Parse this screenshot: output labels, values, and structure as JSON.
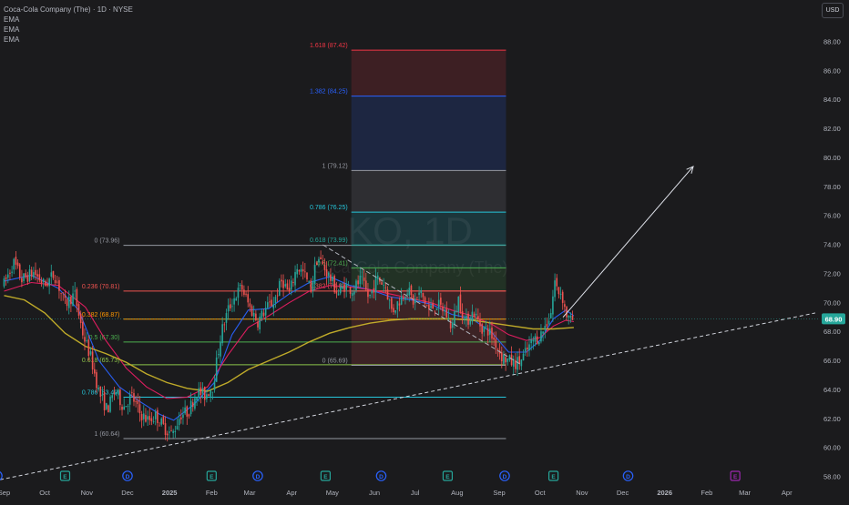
{
  "header": {
    "title": "Coca-Cola Company (The) · 1D · NYSE",
    "indicators": [
      "EMA",
      "EMA",
      "EMA"
    ],
    "currency": "USD"
  },
  "watermark": {
    "ticker": "KO, 1D",
    "name": "Coca-Cola Company (The)"
  },
  "colors": {
    "background": "#1b1b1d",
    "up_candle": "#26a69a",
    "down_candle": "#ef5350",
    "ema_fast": "#2962ff",
    "ema_mid": "#e91e63",
    "ema_slow": "#c8b22a",
    "price_badge": "#26a69a"
  },
  "chart_data": {
    "type": "candlestick",
    "ylim": [
      57.5,
      89.5
    ],
    "y_ticks": [
      "58.00",
      "60.00",
      "62.00",
      "64.00",
      "66.00",
      "68.00",
      "70.00",
      "72.00",
      "74.00",
      "76.00",
      "78.00",
      "80.00",
      "82.00",
      "84.00",
      "86.00",
      "88.00"
    ],
    "x_ticks": [
      {
        "label": "Sep",
        "t": 0
      },
      {
        "label": "Oct",
        "t": 30
      },
      {
        "label": "Nov",
        "t": 61
      },
      {
        "label": "Dec",
        "t": 91
      },
      {
        "label": "2025",
        "t": 122
      },
      {
        "label": "Feb",
        "t": 153
      },
      {
        "label": "Mar",
        "t": 181
      },
      {
        "label": "Apr",
        "t": 212
      },
      {
        "label": "May",
        "t": 242
      },
      {
        "label": "Jun",
        "t": 273
      },
      {
        "label": "Jul",
        "t": 303
      },
      {
        "label": "Aug",
        "t": 334
      },
      {
        "label": "Sep",
        "t": 365
      },
      {
        "label": "Oct",
        "t": 395
      },
      {
        "label": "Nov",
        "t": 426
      },
      {
        "label": "Dec",
        "t": 456
      },
      {
        "label": "2026",
        "t": 487
      },
      {
        "label": "Feb",
        "t": 518
      },
      {
        "label": "Mar",
        "t": 546
      },
      {
        "label": "Apr",
        "t": 577
      }
    ],
    "x_range_days": [
      -3,
      598
    ],
    "current_price": "68.90",
    "price_path": [
      [
        0,
        71.3
      ],
      [
        7,
        72.8
      ],
      [
        13,
        71.6
      ],
      [
        22,
        72.1
      ],
      [
        30,
        71.2
      ],
      [
        37,
        72.0
      ],
      [
        45,
        69.9
      ],
      [
        52,
        70.6
      ],
      [
        58,
        67.9
      ],
      [
        64,
        66.2
      ],
      [
        70,
        63.8
      ],
      [
        76,
        62.6
      ],
      [
        82,
        64.0
      ],
      [
        88,
        62.8
      ],
      [
        94,
        63.6
      ],
      [
        100,
        62.4
      ],
      [
        106,
        61.9
      ],
      [
        112,
        62.2
      ],
      [
        118,
        61.4
      ],
      [
        124,
        60.9
      ],
      [
        130,
        62.3
      ],
      [
        136,
        62.5
      ],
      [
        142,
        63.9
      ],
      [
        148,
        63.6
      ],
      [
        154,
        64.3
      ],
      [
        160,
        67.9
      ],
      [
        165,
        69.5
      ],
      [
        170,
        70.4
      ],
      [
        175,
        71.1
      ],
      [
        181,
        69.7
      ],
      [
        187,
        68.7
      ],
      [
        193,
        69.6
      ],
      [
        199,
        70.1
      ],
      [
        205,
        71.6
      ],
      [
        210,
        70.6
      ],
      [
        216,
        72.5
      ],
      [
        221,
        72.0
      ],
      [
        226,
        70.9
      ],
      [
        231,
        73.2
      ],
      [
        236,
        72.4
      ],
      [
        241,
        71.6
      ],
      [
        246,
        70.6
      ],
      [
        251,
        71.2
      ],
      [
        257,
        70.9
      ],
      [
        263,
        71.6
      ],
      [
        269,
        70.3
      ],
      [
        275,
        71.7
      ],
      [
        281,
        71.2
      ],
      [
        286,
        69.4
      ],
      [
        291,
        70.1
      ],
      [
        297,
        71.0
      ],
      [
        302,
        70.0
      ],
      [
        307,
        70.7
      ],
      [
        313,
        69.5
      ],
      [
        319,
        69.9
      ],
      [
        325,
        69.4
      ],
      [
        330,
        68.3
      ],
      [
        335,
        70.3
      ],
      [
        340,
        68.6
      ],
      [
        346,
        69.4
      ],
      [
        352,
        68.3
      ],
      [
        357,
        68.1
      ],
      [
        362,
        67.3
      ],
      [
        367,
        66.3
      ],
      [
        372,
        66.0
      ],
      [
        376,
        65.8
      ],
      [
        381,
        66.0
      ],
      [
        386,
        66.8
      ],
      [
        390,
        67.4
      ],
      [
        395,
        67.7
      ],
      [
        400,
        68.6
      ],
      [
        403,
        69.3
      ],
      [
        406,
        71.5
      ],
      [
        408,
        70.8
      ],
      [
        411,
        70.7
      ],
      [
        414,
        69.3
      ],
      [
        417,
        68.7
      ],
      [
        420,
        68.9
      ]
    ],
    "series": [
      {
        "role": "ema_fast",
        "values": [
          [
            0,
            71.5
          ],
          [
            20,
            71.9
          ],
          [
            40,
            71.0
          ],
          [
            55,
            69.5
          ],
          [
            70,
            66.0
          ],
          [
            85,
            64.2
          ],
          [
            100,
            63.2
          ],
          [
            115,
            62.3
          ],
          [
            125,
            61.9
          ],
          [
            140,
            63.0
          ],
          [
            155,
            64.5
          ],
          [
            168,
            67.8
          ],
          [
            180,
            69.5
          ],
          [
            195,
            69.6
          ],
          [
            210,
            70.6
          ],
          [
            225,
            71.4
          ],
          [
            240,
            71.8
          ],
          [
            255,
            71.2
          ],
          [
            270,
            70.9
          ],
          [
            285,
            70.4
          ],
          [
            300,
            70.2
          ],
          [
            315,
            69.9
          ],
          [
            330,
            69.2
          ],
          [
            345,
            68.9
          ],
          [
            360,
            67.9
          ],
          [
            372,
            66.6
          ],
          [
            385,
            66.6
          ],
          [
            395,
            67.4
          ],
          [
            405,
            68.9
          ],
          [
            414,
            69.5
          ],
          [
            420,
            69.1
          ]
        ]
      },
      {
        "role": "ema_mid",
        "values": [
          [
            0,
            70.8
          ],
          [
            20,
            71.4
          ],
          [
            40,
            71.2
          ],
          [
            60,
            69.7
          ],
          [
            75,
            67.4
          ],
          [
            90,
            65.5
          ],
          [
            105,
            64.2
          ],
          [
            120,
            63.4
          ],
          [
            135,
            63.5
          ],
          [
            150,
            64.2
          ],
          [
            165,
            66.4
          ],
          [
            180,
            68.3
          ],
          [
            195,
            69.1
          ],
          [
            210,
            70.0
          ],
          [
            225,
            70.8
          ],
          [
            240,
            71.2
          ],
          [
            255,
            71.1
          ],
          [
            270,
            70.9
          ],
          [
            285,
            70.6
          ],
          [
            300,
            70.3
          ],
          [
            315,
            70.0
          ],
          [
            330,
            69.5
          ],
          [
            345,
            69.1
          ],
          [
            360,
            68.5
          ],
          [
            372,
            67.8
          ],
          [
            385,
            67.4
          ],
          [
            395,
            67.6
          ],
          [
            405,
            68.4
          ],
          [
            414,
            68.8
          ],
          [
            420,
            68.7
          ]
        ]
      },
      {
        "role": "ema_slow",
        "values": [
          [
            0,
            70.5
          ],
          [
            15,
            70.2
          ],
          [
            30,
            69.3
          ],
          [
            45,
            67.9
          ],
          [
            60,
            67.0
          ],
          [
            75,
            66.5
          ],
          [
            90,
            65.9
          ],
          [
            105,
            65.1
          ],
          [
            120,
            64.5
          ],
          [
            135,
            64.1
          ],
          [
            150,
            63.9
          ],
          [
            165,
            64.5
          ],
          [
            180,
            65.4
          ],
          [
            195,
            66.0
          ],
          [
            210,
            66.6
          ],
          [
            225,
            67.3
          ],
          [
            240,
            67.9
          ],
          [
            255,
            68.3
          ],
          [
            270,
            68.6
          ],
          [
            285,
            68.8
          ],
          [
            300,
            68.9
          ],
          [
            315,
            68.9
          ],
          [
            330,
            68.9
          ],
          [
            345,
            68.8
          ],
          [
            360,
            68.6
          ],
          [
            375,
            68.4
          ],
          [
            390,
            68.2
          ],
          [
            405,
            68.2
          ],
          [
            420,
            68.3
          ]
        ]
      }
    ],
    "fib_retracement": {
      "t_start": 88,
      "t_end": 370,
      "levels": [
        {
          "label": "1 (60.64)",
          "price": 60.64,
          "color": "#9598a1"
        },
        {
          "label": "0.786 (63.49)",
          "price": 63.49,
          "color": "#26c6da"
        },
        {
          "label": "0.618 (65.73)",
          "price": 65.73,
          "color": "#8bc34a"
        },
        {
          "label": "0.5 (67.30)",
          "price": 67.3,
          "color": "#4caf50"
        },
        {
          "label": "0.382 (68.87)",
          "price": 68.87,
          "color": "#ff9800"
        },
        {
          "label": "0.236 (70.81)",
          "price": 70.81,
          "color": "#ef5350"
        },
        {
          "label": "0 (73.96)",
          "price": 73.96,
          "color": "#9598a1"
        }
      ]
    },
    "fib_extension": {
      "t_start": 256,
      "t_end": 370,
      "levels": [
        {
          "label": "0 (65.69)",
          "price": 65.69,
          "color": "#9598a1"
        },
        {
          "label": "0.382 (70.82)",
          "price": 70.82,
          "color": "#ef5350"
        },
        {
          "label": "0.5 (72.41)",
          "price": 72.41,
          "color": "#4caf50"
        },
        {
          "label": "0.618 (73.99)",
          "price": 73.99,
          "color": "#26a69a"
        },
        {
          "label": "0.786 (76.25)",
          "price": 76.25,
          "color": "#26c6da"
        },
        {
          "label": "1 (79.12)",
          "price": 79.12,
          "color": "#9598a1"
        },
        {
          "label": "1.382 (84.25)",
          "price": 84.25,
          "color": "#2962ff"
        },
        {
          "label": "1.618 (87.42)",
          "price": 87.42,
          "color": "#f23645"
        }
      ]
    },
    "trendline": {
      "from": [
        -3,
        57.8
      ],
      "to": [
        598,
        69.3
      ]
    },
    "zigzag": [
      [
        235,
        74.0
      ],
      [
        256,
        72.8
      ],
      [
        382,
        65.69
      ]
    ],
    "arrow": {
      "from": [
        412,
        69.0
      ],
      "to": [
        508,
        79.4
      ]
    },
    "event_markers": [
      {
        "t": -5,
        "type": "D",
        "color": "#2962ff"
      },
      {
        "t": 45,
        "type": "E",
        "color": "#26a69a"
      },
      {
        "t": 91,
        "type": "D",
        "color": "#2962ff"
      },
      {
        "t": 153,
        "type": "E",
        "color": "#26a69a"
      },
      {
        "t": 187,
        "type": "D",
        "color": "#2962ff"
      },
      {
        "t": 237,
        "type": "E",
        "color": "#26a69a"
      },
      {
        "t": 278,
        "type": "D",
        "color": "#2962ff"
      },
      {
        "t": 327,
        "type": "E",
        "color": "#26a69a"
      },
      {
        "t": 369,
        "type": "D",
        "color": "#2962ff"
      },
      {
        "t": 405,
        "type": "E",
        "color": "#26a69a"
      },
      {
        "t": 460,
        "type": "D",
        "color": "#2962ff"
      },
      {
        "t": 539,
        "type": "E",
        "color": "#9c27b0"
      }
    ]
  }
}
